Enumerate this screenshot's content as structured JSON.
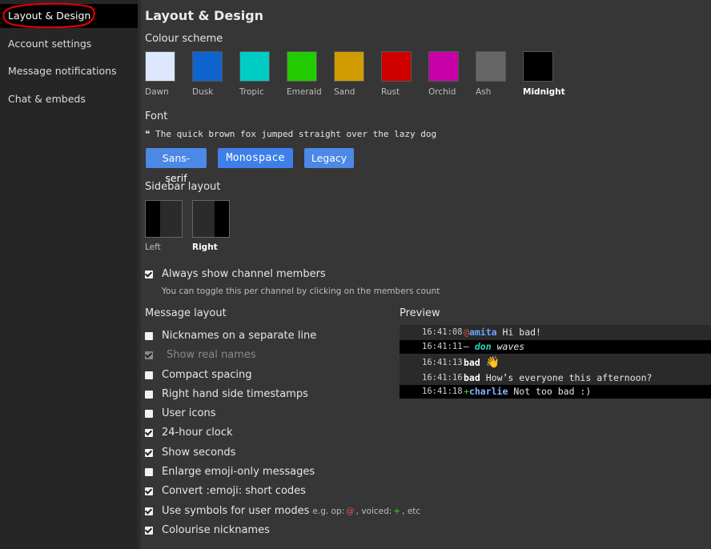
{
  "sidebar": {
    "items": [
      {
        "label": "Layout & Design"
      },
      {
        "label": "Account settings"
      },
      {
        "label": "Message notifications"
      },
      {
        "label": "Chat & embeds"
      }
    ]
  },
  "page": {
    "title": "Layout & Design"
  },
  "colour_scheme": {
    "heading": "Colour scheme",
    "selected": "Midnight",
    "swatches": [
      {
        "label": "Dawn",
        "color": "#dde8ff"
      },
      {
        "label": "Dusk",
        "color": "#0f63cf"
      },
      {
        "label": "Tropic",
        "color": "#00ccc6"
      },
      {
        "label": "Emerald",
        "color": "#22cc00"
      },
      {
        "label": "Sand",
        "color": "#d19c00"
      },
      {
        "label": "Rust",
        "color": "#cf0000"
      },
      {
        "label": "Orchid",
        "color": "#c800a8"
      },
      {
        "label": "Ash",
        "color": "#666666"
      },
      {
        "label": "Midnight",
        "color": "#000000"
      }
    ]
  },
  "font": {
    "heading": "Font",
    "quote_mark": "❝",
    "sample": "The quick brown fox jumped straight over the lazy dog",
    "buttons": [
      "Sans-serif",
      "Monospace",
      "Legacy"
    ]
  },
  "sidebar_layout": {
    "heading": "Sidebar layout",
    "options": [
      "Left",
      "Right"
    ],
    "selected": "Right"
  },
  "members": {
    "label": "Always show channel members",
    "checked": true,
    "hint": "You can toggle this per channel by clicking on the members count"
  },
  "message_layout": {
    "heading": "Message layout",
    "options": [
      {
        "label": "Nicknames on a separate line",
        "checked": false
      },
      {
        "label": "Show real names",
        "checked": true,
        "disabled": true
      },
      {
        "label": "Compact spacing",
        "checked": false
      },
      {
        "label": "Right hand side timestamps",
        "checked": false
      },
      {
        "label": "User icons",
        "checked": false
      },
      {
        "label": "24-hour clock",
        "checked": true
      },
      {
        "label": "Show seconds",
        "checked": true
      },
      {
        "label": "Enlarge emoji-only messages",
        "checked": false
      },
      {
        "label": "Convert :emoji: short codes",
        "checked": true
      },
      {
        "label": "Use symbols for user modes",
        "checked": true
      },
      {
        "label": "Colourise nicknames",
        "checked": true
      }
    ],
    "modes_hint": {
      "prefix": "e.g. op:",
      "op_symbol": "@",
      "voiced_text": ", voiced:",
      "voiced_symbol": "+",
      "suffix": ", etc",
      "op_color": "#e05050",
      "voiced_color": "#3ccf3c"
    }
  },
  "preview": {
    "heading": "Preview",
    "rows": [
      {
        "time": "16:41:08",
        "symbol": "@",
        "nick": "amita",
        "text": "Hi bad!"
      },
      {
        "time": "16:41:11",
        "symbol": "–",
        "nick": "don",
        "text": "waves"
      },
      {
        "time": "16:41:13",
        "nick": "bad",
        "emoji": "👋"
      },
      {
        "time": "16:41:16",
        "nick": "bad",
        "text": "How’s everyone this afternoon?"
      },
      {
        "time": "16:41:18",
        "symbol": "+",
        "nick": "charlie",
        "text": "Not too bad :)"
      }
    ],
    "colors": {
      "amita": "#6aa6ff",
      "don": "#2fd2c2",
      "charlie": "#8ab4ff",
      "op": "#e05050",
      "voiced": "#3ccf3c"
    }
  }
}
